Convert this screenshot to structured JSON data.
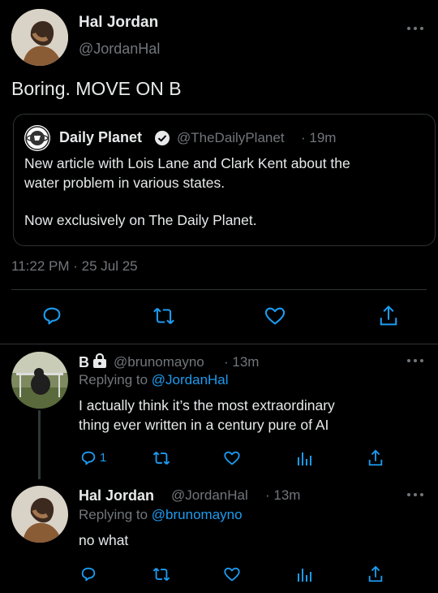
{
  "main_tweet": {
    "author_name": "Hal Jordan",
    "author_handle": "@JordanHal",
    "text": "Boring. MOVE ON B",
    "quote": {
      "name": "Daily Planet",
      "handle": "@TheDailyPlanet",
      "time": "· 19m",
      "line1": "New article with Lois Lane and Clark Kent about the",
      "line2": "water problem in various states.",
      "line3": "Now exclusively on The Daily Planet."
    },
    "timestamp": "11:22 PM · 25 Jul 25",
    "actions": [
      "reply-icon",
      "retweet-icon",
      "like-icon",
      "share-icon"
    ]
  },
  "replies": [
    {
      "name": "B",
      "handle": "@brunomayno",
      "time": "· 13m",
      "replying_prefix": "Replying to",
      "replying_handle": "@JordanHal",
      "line1": "I actually think it’s the most extraordinary",
      "line2": "thing ever written in a century pure of AI",
      "reply_count": "1"
    },
    {
      "name": "Hal Jordan",
      "handle": "@JordanHal",
      "time": "· 13m",
      "replying_prefix": "Replying to",
      "replying_handle": "@brunomayno",
      "line1": "no what"
    }
  ],
  "colors": {
    "background": "#000000",
    "text": "#e7e9ea",
    "secondary": "#71767b",
    "accent": "#1d9bf0",
    "divider": "#2f3336"
  }
}
